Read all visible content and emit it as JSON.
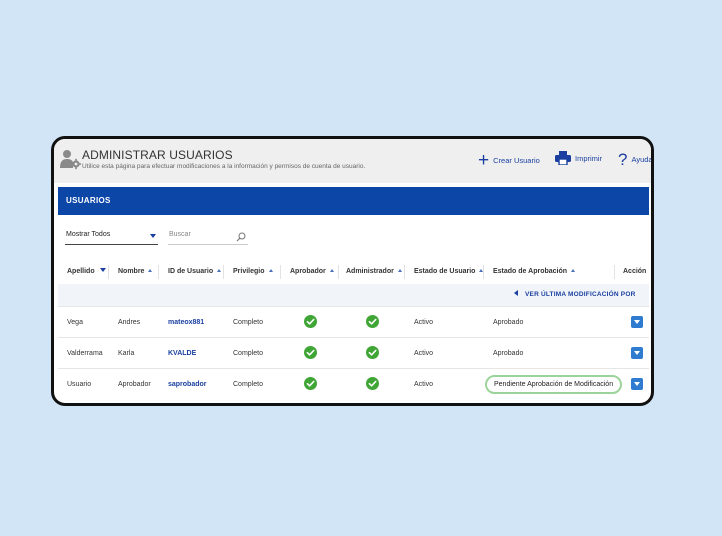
{
  "header": {
    "title": "ADMINISTRAR USUARIOS",
    "subtitle": "Utilice esta página para efectuar modificaciones a la información y permisos de cuenta de usuario.",
    "actions": {
      "create_label": "Crear Usuario",
      "print_label": "Imprimir",
      "help_label": "Ayuda"
    }
  },
  "section": {
    "title": "USUARIOS"
  },
  "filters": {
    "show_selected": "Mostrar Todos",
    "search_placeholder": "Buscar"
  },
  "table": {
    "columns": [
      "Apellido",
      "Nombre",
      "ID de Usuario",
      "Privilegio",
      "Aprobador",
      "Administrador",
      "Estado de Usuario",
      "Estado de Aprobación",
      "Acción"
    ],
    "sort_column": "Apellido",
    "subheader_link": "VER ÚLTIMA MODIFICACIÓN POR",
    "rows": [
      {
        "apellido": "Vega",
        "nombre": "Andres",
        "id": "mateox881",
        "privilegio": "Completo",
        "aprobador": true,
        "administrador": true,
        "estado_usuario": "Activo",
        "estado_aprobacion": "Aprobado",
        "highlighted": false
      },
      {
        "apellido": "Valderrama",
        "nombre": "Karla",
        "id": "KVALDE",
        "privilegio": "Completo",
        "aprobador": true,
        "administrador": true,
        "estado_usuario": "Activo",
        "estado_aprobacion": "Aprobado",
        "highlighted": false
      },
      {
        "apellido": "Usuario",
        "nombre": "Aprobador",
        "id": "saprobador",
        "privilegio": "Completo",
        "aprobador": true,
        "administrador": true,
        "estado_usuario": "Activo",
        "estado_aprobacion": "Pendiente Aprobación de Modificación",
        "highlighted": true
      }
    ]
  },
  "icons": {
    "header": "user-gear-icon",
    "create": "plus-icon",
    "print": "printer-icon",
    "help": "question-icon",
    "search": "search-icon",
    "check": "check-circle-icon",
    "action": "chevron-down-icon"
  },
  "colors": {
    "background": "#d2e5f6",
    "band": "#0c47a8",
    "link": "#1a3fa0",
    "check": "#3fa535",
    "pending_border": "#9bd49b",
    "action_button": "#2f7bd0"
  }
}
